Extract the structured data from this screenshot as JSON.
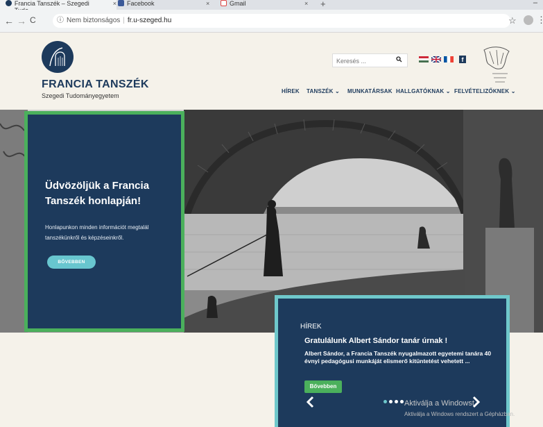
{
  "browser": {
    "tabs": [
      {
        "title": "Francia Tanszék – Szegedi Tudo…",
        "close": "×"
      },
      {
        "title": "Facebook",
        "close": "×"
      },
      {
        "title": "Gmail",
        "close": "×"
      }
    ],
    "new_tab": "+",
    "window_controls": "–",
    "nav": {
      "back": "←",
      "forward": "→",
      "reload": "C"
    },
    "info_icon": "ⓘ",
    "security": "Nem biztonságos",
    "separator": "|",
    "url": "fr.u-szeged.hu",
    "star": "☆",
    "menu": "⋮"
  },
  "site": {
    "title": "FRANCIA TANSZÉK",
    "subtitle": "Szegedi Tudományegyetem",
    "search_placeholder": "Keresés ...",
    "search_icon": "🔍",
    "facebook": "f",
    "nav": [
      {
        "label": "HÍREK"
      },
      {
        "label": "TANSZÉK ⌄"
      },
      {
        "label": "MUNKATÁRSAK"
      },
      {
        "label": "HALLGATÓKNAK ⌄"
      },
      {
        "label": "FELVÉTELIZŐKNEK ⌄"
      }
    ]
  },
  "welcome": {
    "heading": "Üdvözöljük a Francia Tanszék honlapján!",
    "body": "Honlapunkon minden információt megtalál tanszékünkről és képzéseinkről.",
    "button": "BŐVEBBEN"
  },
  "news": {
    "label": "HÍREK",
    "headline": "Gratulálunk Albert Sándor tanár úrnak !",
    "text": "Albert Sándor,  a Francia Tanszék nyugalmazott egyetemi tanára 40 évnyi pedagógusi munkáját elismerő kitüntetést vehetett ...",
    "button": "Bővebben",
    "prev": "‹",
    "next": "›"
  },
  "watermark": {
    "line1": "Aktiválja a Windowst",
    "line2": "Aktiválja a Windows rendszert a Gépházban."
  },
  "colors": {
    "navy": "#1d3a5c",
    "green_border": "#4bb05c",
    "teal_border": "#6fc8cb",
    "background": "#f5f2ea"
  }
}
